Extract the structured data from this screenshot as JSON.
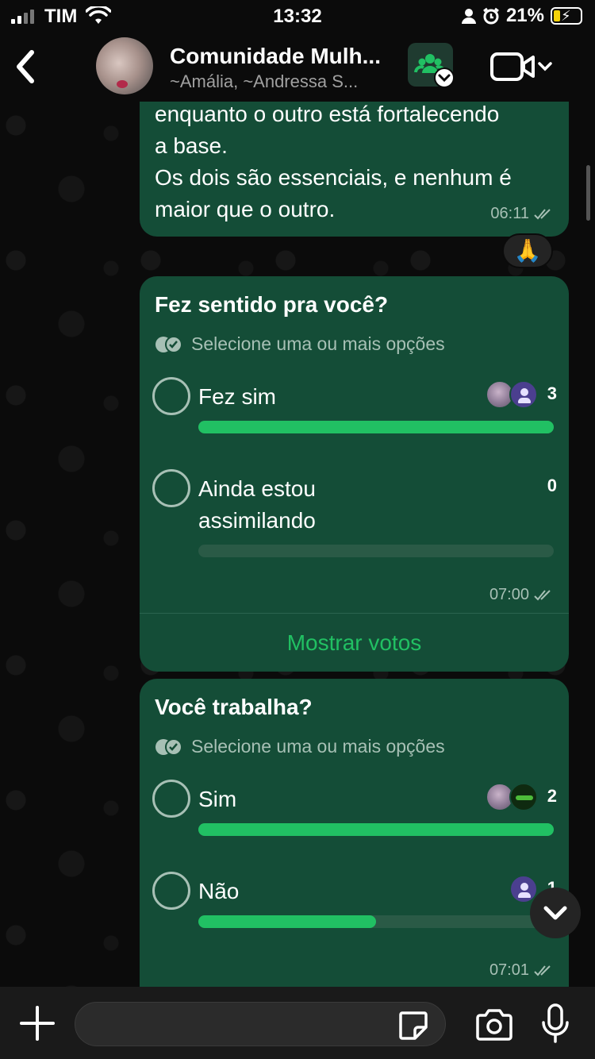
{
  "status_bar": {
    "carrier": "TIM",
    "time": "13:32",
    "battery": "21%",
    "battery_level_pct": 21
  },
  "header": {
    "title": "Comunidade Mulh...",
    "subtitle": "~Amália, ~Andressa S...",
    "icons": [
      "back-icon",
      "community-icon",
      "video-call-icon",
      "chevron-down-icon"
    ]
  },
  "messages": {
    "text_message": {
      "lines": [
        "enquanto o outro está fortalecendo",
        "a base.",
        "Os dois são essenciais, e nenhum é",
        "maior que o outro."
      ],
      "time": "06:11",
      "reaction": "🙏"
    },
    "poll1": {
      "question": "Fez sentido pra você?",
      "hint": "Selecione uma ou mais opções",
      "options": [
        {
          "label_lines": [
            "Fez sim"
          ],
          "count": "3",
          "fill_pct": 100
        },
        {
          "label_lines": [
            "Ainda estou",
            "assimilando"
          ],
          "count": "0",
          "fill_pct": 0
        }
      ],
      "time": "07:00",
      "show_votes": "Mostrar votos"
    },
    "poll2": {
      "question": "Você trabalha?",
      "hint": "Selecione uma ou mais opções",
      "options": [
        {
          "label_lines": [
            "Sim"
          ],
          "count": "2",
          "fill_pct": 100
        },
        {
          "label_lines": [
            "Não"
          ],
          "count": "1",
          "fill_pct": 50
        }
      ],
      "time": "07:01"
    }
  },
  "input_bar": {
    "icons": [
      "plus-icon",
      "sticker-icon",
      "camera-icon",
      "microphone-icon"
    ]
  },
  "colors": {
    "bubble": "#144d37",
    "accent": "#21c063",
    "background": "#0b0b0b"
  }
}
